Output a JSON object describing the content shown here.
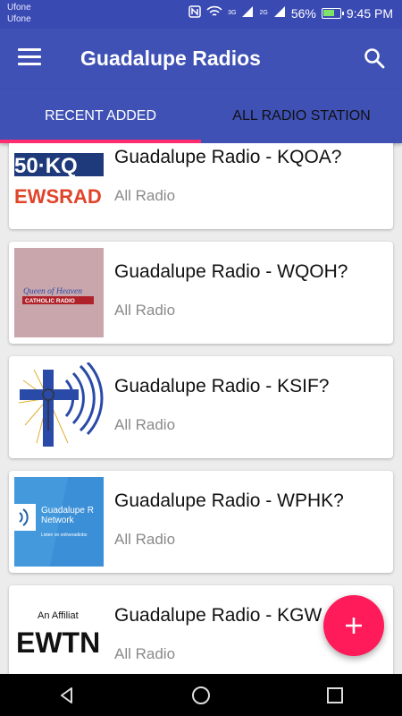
{
  "status_bar": {
    "carrier_1": "Ufone",
    "carrier_2": "Ufone",
    "network_3g": "3G",
    "network_2g": "2G",
    "battery": "56%",
    "time": "9:45 PM"
  },
  "app_bar": {
    "title": "Guadalupe Radios",
    "menu_icon": "menu-icon",
    "search_icon": "search-icon"
  },
  "tabs": [
    {
      "label": "RECENT ADDED",
      "active": true
    },
    {
      "label": "ALL RADIO STATION",
      "active": false
    }
  ],
  "stations": [
    {
      "title": "Guadalupe Radio - KQOA?",
      "subtitle": "All Radio",
      "logo_text_1": "50·KQ",
      "logo_text_2": "EWSRAD"
    },
    {
      "title": "Guadalupe Radio - WQOH?",
      "subtitle": "All Radio",
      "logo_text_1": "Queen of Heaven",
      "logo_text_2": "CATHOLIC RADIO"
    },
    {
      "title": "Guadalupe Radio - KSIF?",
      "subtitle": "All Radio"
    },
    {
      "title": "Guadalupe Radio - WPHK?",
      "subtitle": "All Radio",
      "logo_text_1": "Guadalupe R",
      "logo_text_2": "Network",
      "logo_text_3": "Listen on onliveradiobo"
    },
    {
      "title": "Guadalupe Radio - KGW",
      "subtitle": "All Radio",
      "logo_text_1": "An Affiliat",
      "logo_text_2": "EWTN"
    }
  ],
  "fab": {
    "icon": "plus-icon",
    "label": "+"
  },
  "colors": {
    "primary": "#3f51b5",
    "accent": "#ff1a5a",
    "tab_indicator": "#ff2d6f"
  }
}
